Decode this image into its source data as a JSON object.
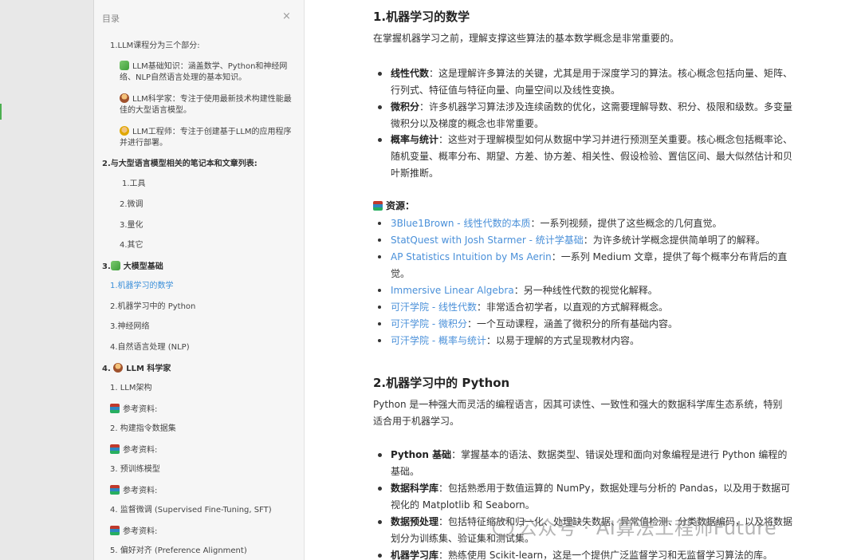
{
  "sidebar": {
    "title": "目录",
    "close_icon": "×",
    "items": [
      {
        "label": "1.LLM课程分为三个部分:"
      },
      {
        "label": "LLM基础知识：涵盖数学、Python和神经网络、NLP自然语言处理的基本知识。",
        "icon": "puzzle-icon"
      },
      {
        "label": "LLM科学家：专注于使用最新技术构建性能最佳的大型语言模型。",
        "icon": "scientist-icon"
      },
      {
        "label": "LLM工程师：专注于创建基于LLM的应用程序并进行部署。",
        "icon": "engineer-icon"
      },
      {
        "label": "2.与大型语言模型相关的笔记本和文章列表:"
      },
      {
        "label": "1.工具"
      },
      {
        "label": "2.微调"
      },
      {
        "label": "3.量化"
      },
      {
        "label": "4.其它"
      },
      {
        "label": "大模型基础",
        "prefix": "3."
      },
      {
        "label": "1.机器学习的数学"
      },
      {
        "label": "2.机器学习中的 Python"
      },
      {
        "label": "3.神经网络"
      },
      {
        "label": "4.自然语言处理 (NLP)"
      },
      {
        "label": "LLM 科学家",
        "prefix": "4."
      },
      {
        "label": "1. LLM架构"
      },
      {
        "label": "参考资料:"
      },
      {
        "label": "2. 构建指令数据集"
      },
      {
        "label": "参考资料:"
      },
      {
        "label": "3. 预训练模型"
      },
      {
        "label": "参考资料:"
      },
      {
        "label": "4. 监督微调 (Supervised Fine-Tuning, SFT)"
      },
      {
        "label": "参考资料:"
      },
      {
        "label": "5. 偏好对齐 (Preference Alignment)"
      }
    ]
  },
  "main": {
    "section1": {
      "title": "1.机器学习的数学",
      "intro": "在掌握机器学习之前，理解支撑这些算法的基本数学概念是非常重要的。",
      "bullets": [
        {
          "term": "线性代数",
          "text": "：这是理解许多算法的关键，尤其是用于深度学习的算法。核心概念包括向量、矩阵、行列式、特征值与特征向量、向量空间以及线性变换。"
        },
        {
          "term": "微积分",
          "text": "：许多机器学习算法涉及连续函数的优化，这需要理解导数、积分、极限和级数。多变量微积分以及梯度的概念也非常重要。"
        },
        {
          "term": "概率与统计",
          "text": "：这些对于理解模型如何从数据中学习并进行预测至关重要。核心概念包括概率论、随机变量、概率分布、期望、方差、协方差、相关性、假设检验、置信区间、最大似然估计和贝叶斯推断。"
        }
      ],
      "resources_label": "资源：",
      "resources": [
        {
          "link": "3Blue1Brown - 线性代数的本质",
          "text": "：一系列视频，提供了这些概念的几何直觉。"
        },
        {
          "link": "StatQuest with Josh Starmer - 统计学基础",
          "text": "：为许多统计学概念提供简单明了的解释。"
        },
        {
          "link": "AP Statistics Intuition by Ms Aerin",
          "text": "：一系列 Medium 文章，提供了每个概率分布背后的直觉。"
        },
        {
          "link": "Immersive Linear Algebra",
          "text": "：另一种线性代数的视觉化解释。"
        },
        {
          "link": "可汗学院 - 线性代数",
          "text": "：非常适合初学者，以直观的方式解释概念。"
        },
        {
          "link": "可汗学院 - 微积分",
          "text": "：一个互动课程，涵盖了微积分的所有基础内容。"
        },
        {
          "link": "可汗学院 - 概率与统计",
          "text": "：以易于理解的方式呈现教材内容。"
        }
      ]
    },
    "section2": {
      "title": "2.机器学习中的 Python",
      "intro": "Python 是一种强大而灵活的编程语言，因其可读性、一致性和强大的数据科学库生态系统，特别适合用于机器学习。",
      "bullets": [
        {
          "term": "Python 基础",
          "text": "：掌握基本的语法、数据类型、错误处理和面向对象编程是进行 Python 编程的基础。"
        },
        {
          "term": "数据科学库",
          "text": "：包括熟悉用于数值运算的 NumPy，数据处理与分析的 Pandas，以及用于数据可视化的 Matplotlib 和 Seaborn。"
        },
        {
          "term": "数据预处理",
          "text": "：包括特征缩放和归一化、处理缺失数据、异常值检测、分类数据编码，以及将数据划分为训练集、验证集和测试集。"
        },
        {
          "term": "机器学习库",
          "text": "：熟练使用 Scikit-learn，这是一个提供广泛监督学习和无监督学习算法的库。"
        }
      ]
    },
    "watermark": "公众号 · AI算法工程师Future"
  }
}
